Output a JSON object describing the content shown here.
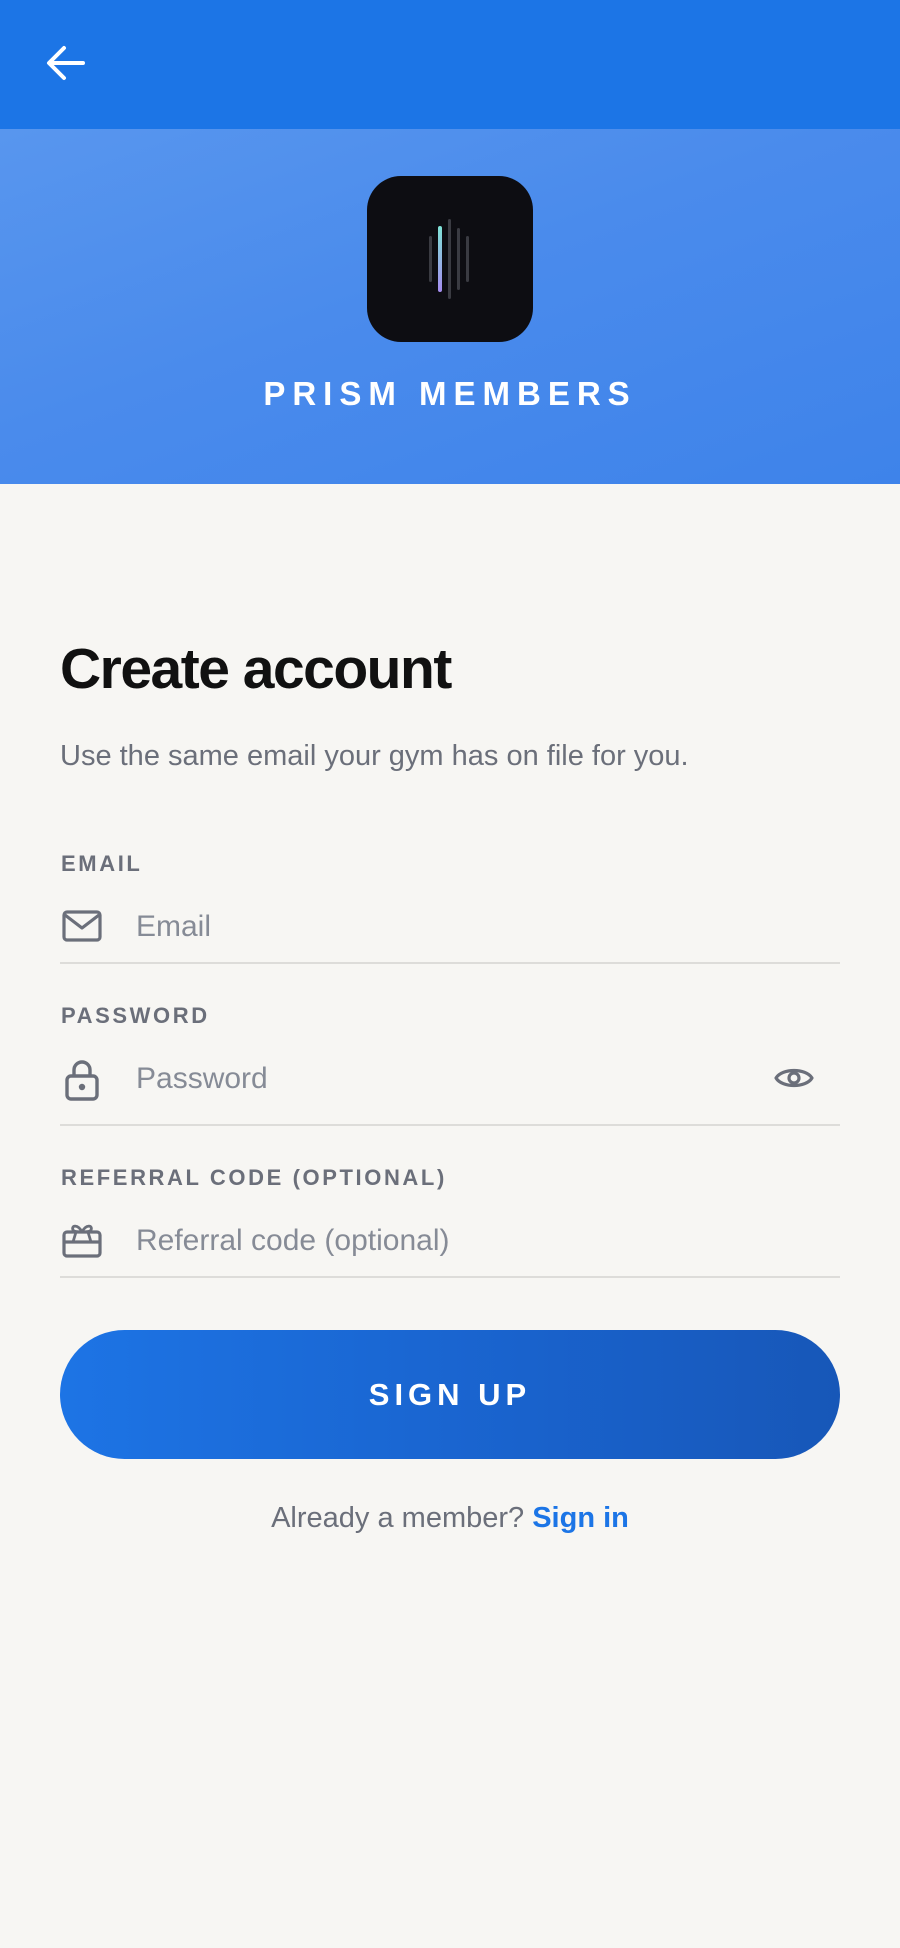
{
  "topbar": {
    "back_icon": "arrow-left-icon",
    "color": "#1c75e6"
  },
  "hero": {
    "logo_icon": "prism-logo-icon",
    "brand_name": "PRISM MEMBERS",
    "color": "#4a8bec"
  },
  "form": {
    "title": "Create account",
    "subtitle": "Use the same email your gym has on file for you.",
    "email": {
      "label": "EMAIL",
      "placeholder": "Email",
      "value": "",
      "icon": "mail-icon"
    },
    "password": {
      "label": "PASSWORD",
      "placeholder": "Password",
      "value": "",
      "icon": "lock-icon",
      "toggle_icon": "eye-icon"
    },
    "referral": {
      "label": "REFERRAL CODE (OPTIONAL)",
      "placeholder": "Referral code (optional)",
      "value": "",
      "icon": "gift-card-icon"
    },
    "submit_label": "SIGN UP",
    "signin_prompt": "Already a member?",
    "signin_link": "Sign in"
  },
  "colors": {
    "accent": "#1c75e6",
    "background": "#f7f6f3",
    "muted_text": "#6b6f7a"
  }
}
